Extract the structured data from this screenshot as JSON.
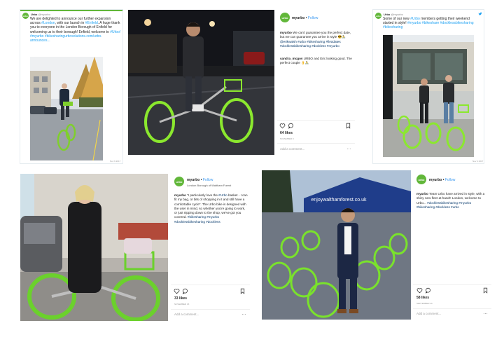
{
  "tweet1": {
    "account": "Urbo",
    "handle": "@myurbo",
    "text_before_london": "We are delighted to announce our further expansion across ",
    "london_link": "#London",
    "text_mid": ", with our launch in ",
    "enfield_link": "#Enfield",
    "text_after": ". A huge thank you to everyone in the London Borough of Enfield  for welcoming us to their borough! Enfield, welcome to ",
    "urbo_link": "#Urbo!",
    "myurbo_link": "#myurbo",
    "url": "#bikesharingurbosolutions.com/urbo-announces...",
    "timestamp": "Nov 6 2017"
  },
  "post_top_ig": {
    "account": "myurbo",
    "follow": "Follow",
    "caption_user": "myurbo",
    "caption_text": " We can't guarantee you the perfect date, but we can guarantee you arrive in style ",
    "mention": "@erikwalsh",
    "emoji1": "😎🚴",
    "hashtags": "#urbo #bikesharing #firstdates #docklessbikesharing #dockless #myurbo",
    "comment_user": "sandra_mcgov",
    "comment_text": " URBO and Eric looking good. The perfect couple 👌🚴",
    "likes": "64 likes",
    "date": "NOVEMBER 9",
    "add_comment": "Add a comment..."
  },
  "tweet2": {
    "account": "Urbo",
    "handle": "@myurbo",
    "text_before": "Some of our new ",
    "urbo_link": "#Urbo",
    "text_mid": " members getting their weekend started in style! ",
    "tags_1": "#myurbo #bikeshare",
    "tags_2": "#docklessbikesharing #bikesharing",
    "timestamp": "Nov 4 2017"
  },
  "post_bottom_left": {
    "account": "myurbo",
    "follow": "Follow",
    "location": "London Borough of Waltham Forest",
    "caption_user": "myurbo",
    "caption_text": " \"I particularly love the ",
    "urbo_link": "#Urbo",
    "caption_text2": " basket - I can fit my bag, or bits of shopping in it and still have a comfortable cycle\". The Urbo bike is designed with the user in mind, so whether you're going to work, or just nipping down to the shop, we've got you covered. ",
    "hashtags": "#bikesharing #myurbo #docklessbikesharing #dockless",
    "likes": "33 likes",
    "date": "NOVEMBER 15",
    "add_comment": "Add a comment..."
  },
  "post_bottom_right": {
    "account": "myurbo",
    "follow": "Follow",
    "caption_user": "myurbo",
    "caption_text": " Team Urbo have arrived in style, with a shiny new fleet at hand!! London, welcome to Urbo... ",
    "hashtags": "#docklessbikesharing #myurbo #bikesharing #dockless #urbo",
    "likes": "58 likes",
    "date": "SEPTEMBER 26",
    "add_comment": "Add a comment...",
    "tent_banner": "enjoywalthamforest.co.uk"
  },
  "colors": {
    "urbo_green": "#62b73a",
    "lime_tyre": "#8ee62c",
    "twitter_blue": "#1da1f2",
    "instagram_link": "#003569"
  },
  "icons": [
    "heart-icon",
    "comment-icon",
    "bookmark-icon",
    "twitter-bird-icon",
    "more-options-icon"
  ]
}
